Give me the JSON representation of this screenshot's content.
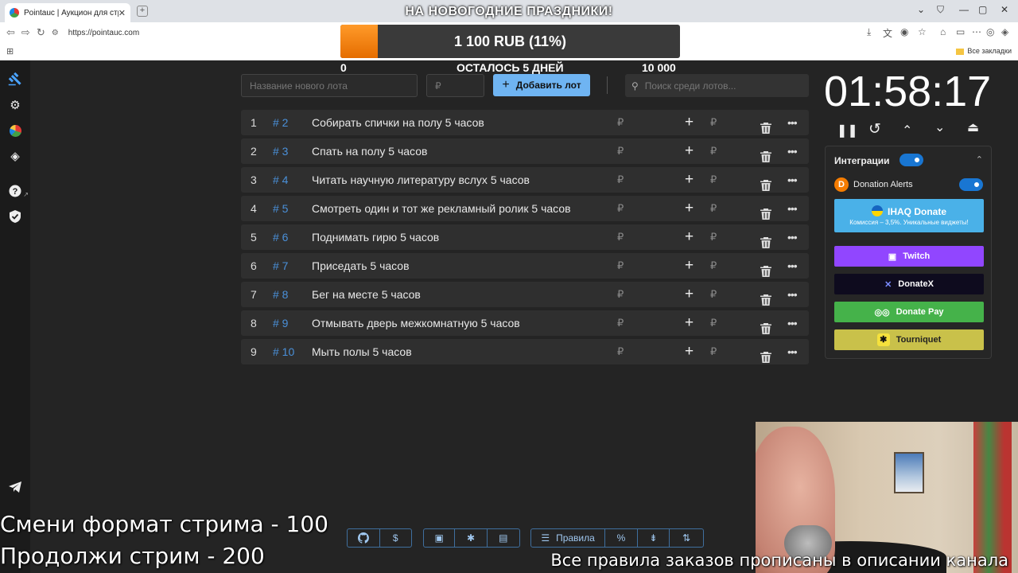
{
  "browser": {
    "tab_title": "Pointauc | Аукцион для стриме…",
    "url": "https://pointauc.com",
    "bookmarks_all": "Все закладки"
  },
  "progress": {
    "promo": "НА НОВОГОДНИЕ ПРАЗДНИКИ!",
    "amount_label": "1 100 RUB (11%)",
    "fraction": 0.11,
    "min": "0",
    "max": "10 000",
    "days_left": "ОСТАЛОСЬ 5 ДНЕЙ"
  },
  "toolbar": {
    "lot_name_placeholder": "Название нового лота",
    "amount_placeholder": "₽",
    "add_button": "Добавить лот",
    "search_placeholder": "Поиск среди лотов..."
  },
  "currency": "₽",
  "lots": [
    {
      "num": "1",
      "id": "# 2",
      "title": "Собирать спички на полу 5 часов"
    },
    {
      "num": "2",
      "id": "# 3",
      "title": "Спать на полу 5 часов"
    },
    {
      "num": "3",
      "id": "# 4",
      "title": "Читать научную литературу вслух 5 часов"
    },
    {
      "num": "4",
      "id": "# 5",
      "title": "Смотреть один и тот же рекламный ролик 5 часов"
    },
    {
      "num": "5",
      "id": "# 6",
      "title": "Поднимать гирю 5 часов"
    },
    {
      "num": "6",
      "id": "# 7",
      "title": "Приседать 5 часов"
    },
    {
      "num": "7",
      "id": "# 8",
      "title": "Бег на месте 5 часов"
    },
    {
      "num": "8",
      "id": "# 9",
      "title": "Отмывать дверь межкомнатную 5 часов"
    },
    {
      "num": "9",
      "id": "# 10",
      "title": "Мыть полы 5 часов"
    }
  ],
  "timer": {
    "value": "01:58:17"
  },
  "integrations": {
    "title": "Интеграции",
    "donation_alerts": "Donation Alerts",
    "ihaq_title": "IHAQ Donate",
    "ihaq_sub": "Комиссия – 3,5%. Уникальные виджеты!",
    "twitch": "Twitch",
    "donatex": "DonateX",
    "donatepay": "Donate Pay",
    "tourniquet": "Tourniquet"
  },
  "bottom_bar": {
    "rules": "Правила"
  },
  "stream": {
    "line1": "Смени формат стрима - 100",
    "line2": "Продолжи стрим - 200",
    "ticker": "Все правила заказов прописаны в описании канала"
  },
  "colors": {
    "accent": "#6fb4f2",
    "progress": "#ff8a1a",
    "twitch": "#9146ff",
    "donatepay": "#45b24a",
    "tourniquet": "#c9c14a",
    "ihaq": "#4ab1e8"
  }
}
